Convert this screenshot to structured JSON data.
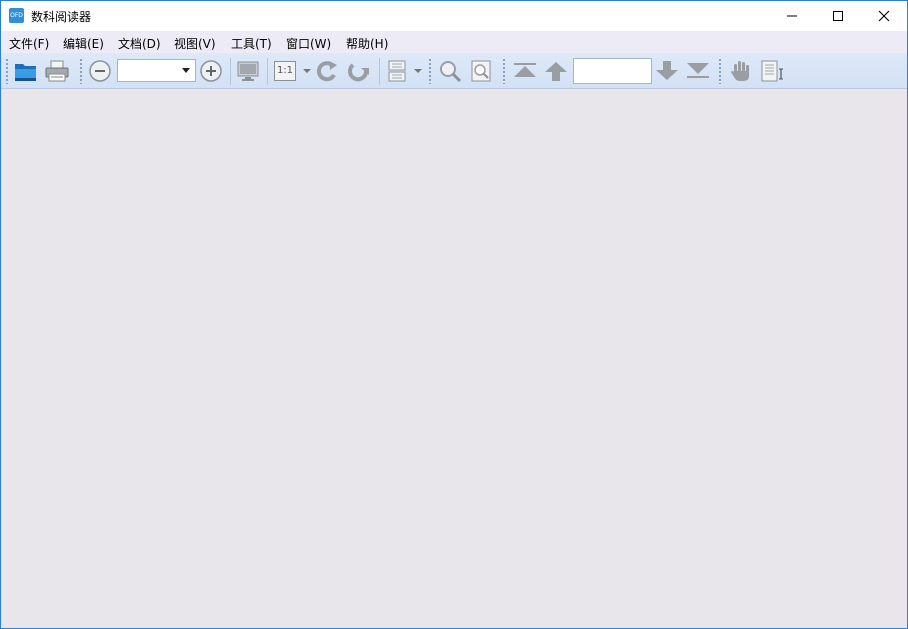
{
  "window": {
    "title": "数科阅读器",
    "app_icon_text": "OFD"
  },
  "menubar": {
    "items": [
      {
        "label": "文件(F)"
      },
      {
        "label": "编辑(E)"
      },
      {
        "label": "文档(D)"
      },
      {
        "label": "视图(V)"
      },
      {
        "label": "工具(T)"
      },
      {
        "label": "窗口(W)"
      },
      {
        "label": "帮助(H)"
      }
    ]
  },
  "toolbar": {
    "zoom_value": "",
    "actual_size_label": "1:1",
    "page_number_value": ""
  },
  "colors": {
    "accent": "#2f8fd8",
    "toolbar_bg": "#d6e3f6",
    "content_bg": "#e8e6ea"
  }
}
